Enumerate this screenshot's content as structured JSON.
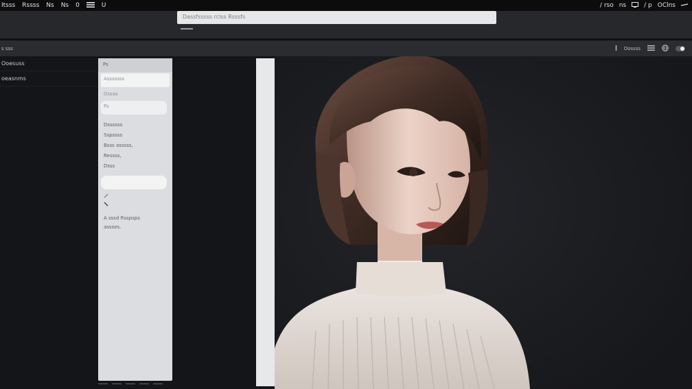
{
  "menubar": {
    "items": [
      "Itsss",
      "Rssss",
      "Ns",
      "Ns",
      "0",
      "U"
    ],
    "right": [
      "/ rso",
      "ns",
      "rs",
      "/ p",
      "OClns"
    ]
  },
  "header": {
    "url": "Dassfsssss rclss Rsssfs"
  },
  "toolbar": {
    "path": "s sss",
    "zoom": "Oossss"
  },
  "sidebar": {
    "items": [
      "Ooesuss",
      "oeasnms"
    ]
  },
  "panel": {
    "header": "Ps",
    "field1": "Asssssss",
    "field2": "Ossas",
    "field3": "Ps",
    "options": [
      "Dssssss",
      "Sspssss",
      "Bsss asssss,",
      "Ressss,",
      "Dsss"
    ],
    "note": [
      "A sssd Rsspsps",
      "assses."
    ]
  },
  "canvas": {
    "palette": {
      "background": "#191a1e",
      "hair": "#3b2a25",
      "skin": "#e6c9bd",
      "blouse": "#e9e1dc"
    }
  }
}
